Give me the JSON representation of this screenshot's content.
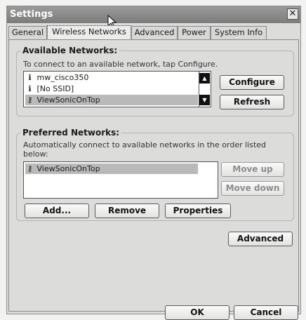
{
  "window": {
    "title": "Settings",
    "close_label": "✕"
  },
  "tabs": [
    {
      "label": "General",
      "active": false
    },
    {
      "label": "Wireless Networks",
      "active": true
    },
    {
      "label": "Advanced",
      "active": false
    },
    {
      "label": "Power",
      "active": false
    },
    {
      "label": "System Info",
      "active": false
    }
  ],
  "available": {
    "heading": "Available Networks:",
    "instruction": "To connect to an available network, tap Configure.",
    "networks": [
      {
        "name": "mw_cisco350",
        "icon": "signal-icon",
        "selected": false
      },
      {
        "name": "[No SSID]",
        "icon": "signal-icon",
        "selected": false
      },
      {
        "name": "ViewSonicOnTop",
        "icon": "key-icon",
        "selected": true
      }
    ],
    "configure_label": "Configure",
    "refresh_label": "Refresh"
  },
  "preferred": {
    "heading": "Preferred Networks:",
    "instruction": "Automatically connect to available networks in the order listed below:",
    "networks": [
      {
        "name": "ViewSonicOnTop",
        "icon": "key-icon",
        "selected": true
      }
    ],
    "move_up_label": "Move up",
    "move_down_label": "Move down",
    "add_label": "Add...",
    "remove_label": "Remove",
    "properties_label": "Properties"
  },
  "advanced_label": "Advanced",
  "ok_label": "OK",
  "cancel_label": "Cancel",
  "colors": {
    "titlebar": "#8a8a8a",
    "selection": "#b9b9b9",
    "window": "#dcdcda"
  }
}
